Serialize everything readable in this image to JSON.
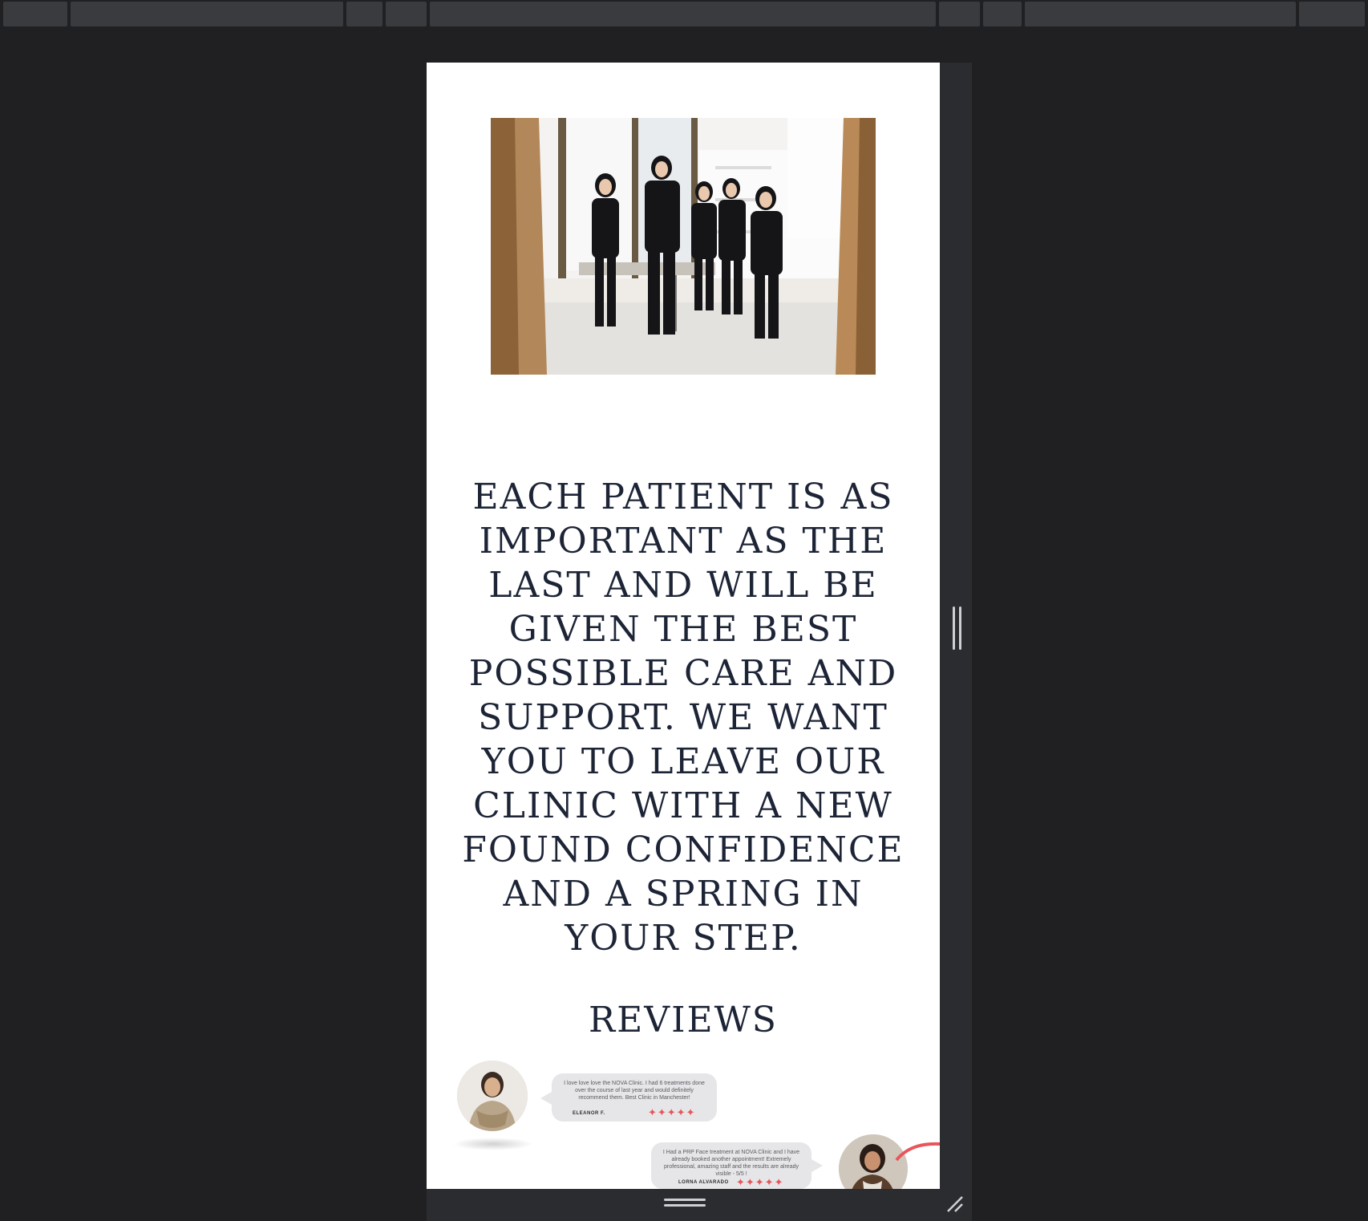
{
  "page": {
    "headline": "EACH PATIENT IS AS IMPORTANT AS THE LAST AND WILL BE GIVEN THE BEST POSSIBLE CARE AND SUPPORT. WE WANT YOU TO LEAVE OUR CLINIC WITH A NEW FOUND CONFIDENCE AND A SPRING IN YOUR STEP.",
    "reviews_title": "REVIEWS"
  },
  "photo": {
    "icon": "team-photo"
  },
  "reviews": [
    {
      "text": "I love love love the NOVA Clinic. I had 6 treatments done over the course of last year and would definitely recommend them. Best Clinic in Manchester!",
      "name": "ELEANOR F.",
      "stars": "✦✦✦✦✦"
    },
    {
      "text": "I Had a PRP Face treatment at NOVA Clinic and I have already booked another appointment! Extremely professional, amazing staff and the results are already visible - 5/5 !",
      "name": "LORNA ALVARADO",
      "stars": "✦✦✦✦✦"
    }
  ],
  "colors": {
    "heading": "#1c2436",
    "star": "#e8555a",
    "bubble": "#e6e6e8",
    "backdrop": "#202023"
  }
}
